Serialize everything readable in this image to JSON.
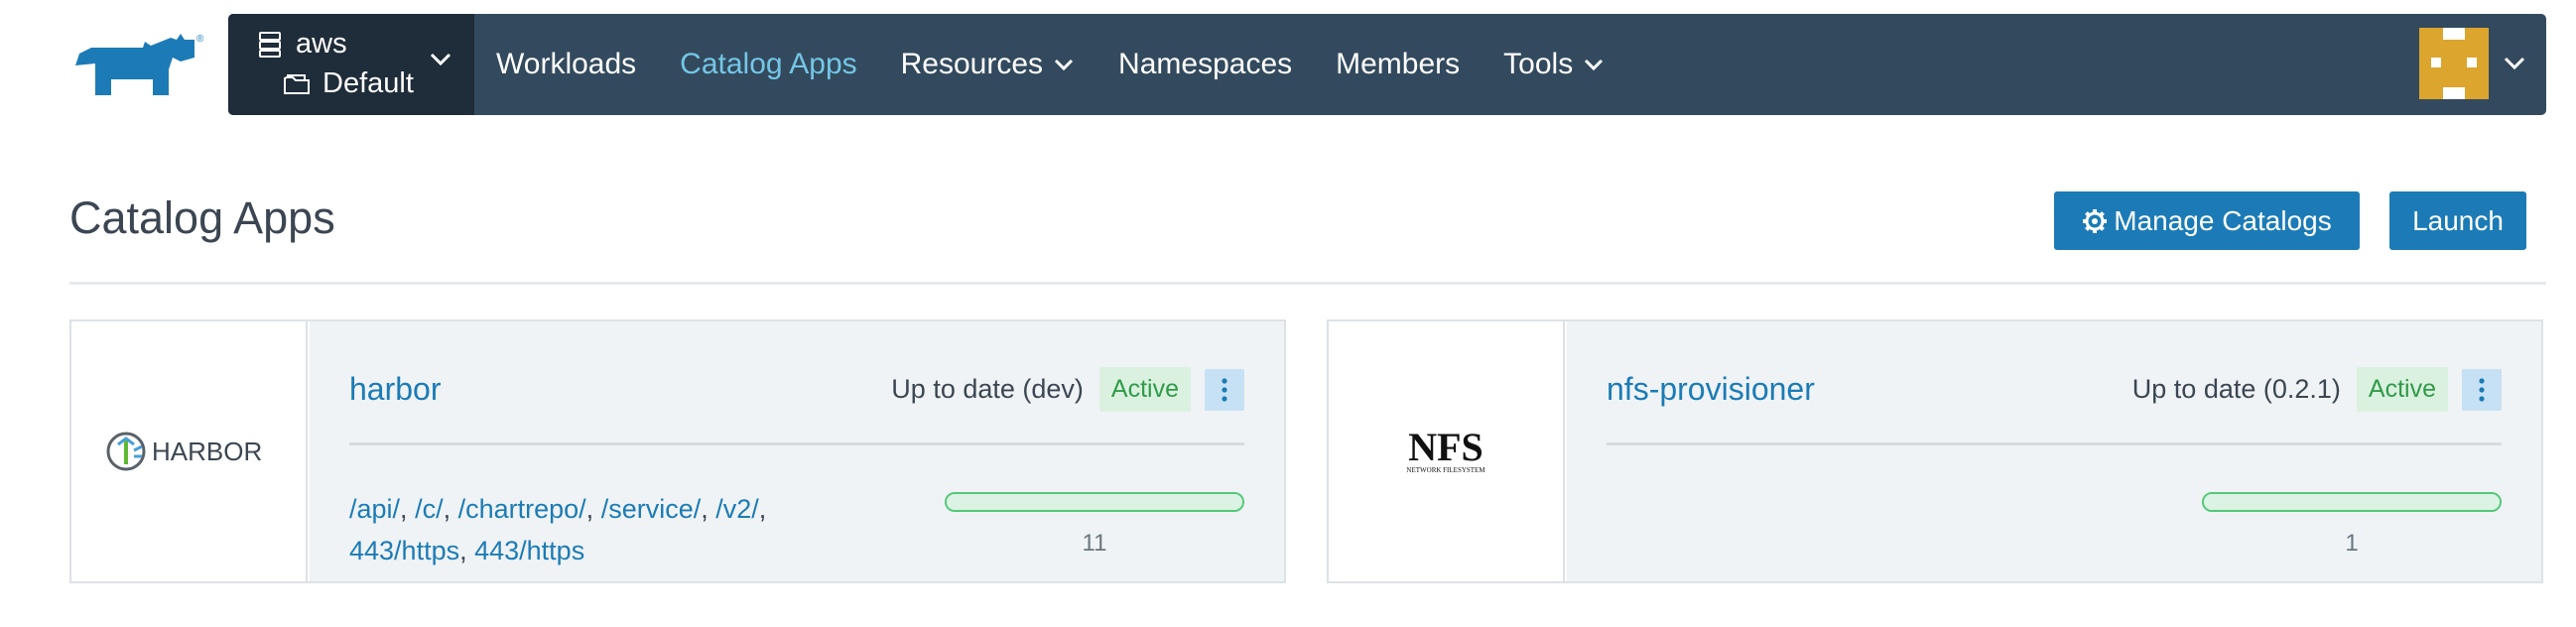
{
  "header": {
    "cluster": "aws",
    "project": "Default",
    "nav": [
      {
        "label": "Workloads",
        "active": false,
        "dropdown": false
      },
      {
        "label": "Catalog Apps",
        "active": true,
        "dropdown": false
      },
      {
        "label": "Resources",
        "active": false,
        "dropdown": true
      },
      {
        "label": "Namespaces",
        "active": false,
        "dropdown": false
      },
      {
        "label": "Members",
        "active": false,
        "dropdown": false
      },
      {
        "label": "Tools",
        "active": false,
        "dropdown": true
      }
    ],
    "icons": {
      "logo": "rancher-logo",
      "cluster": "server-stack-icon",
      "project": "folder-icon",
      "user": "identicon-avatar"
    }
  },
  "page": {
    "title": "Catalog Apps",
    "manage_label": "Manage Catalogs",
    "launch_label": "Launch"
  },
  "apps": [
    {
      "name": "harbor",
      "logo_text": "HARBOR",
      "version": "Up to date (dev)",
      "state": "Active",
      "endpoints": [
        "/api/",
        "/c/",
        "/chartrepo/",
        "/service/",
        "/v2/",
        "443/https",
        "443/https"
      ],
      "ready_fraction": 1.0,
      "count": "11"
    },
    {
      "name": "nfs-provisioner",
      "logo_text": "NFS",
      "logo_subtext": "NETWORK FILESYSTEM",
      "version": "Up to date (0.2.1)",
      "state": "Active",
      "endpoints": [],
      "ready_fraction": 1.0,
      "count": "1"
    }
  ],
  "colors": {
    "nav_bg": "#334a5e",
    "nav_context_bg": "#1f2c39",
    "nav_active": "#74c6e5",
    "primary": "#1c7bb6",
    "active_badge_bg": "#dbf1e0",
    "active_badge_text": "#2f9b48",
    "progress_border": "#53c87a"
  }
}
